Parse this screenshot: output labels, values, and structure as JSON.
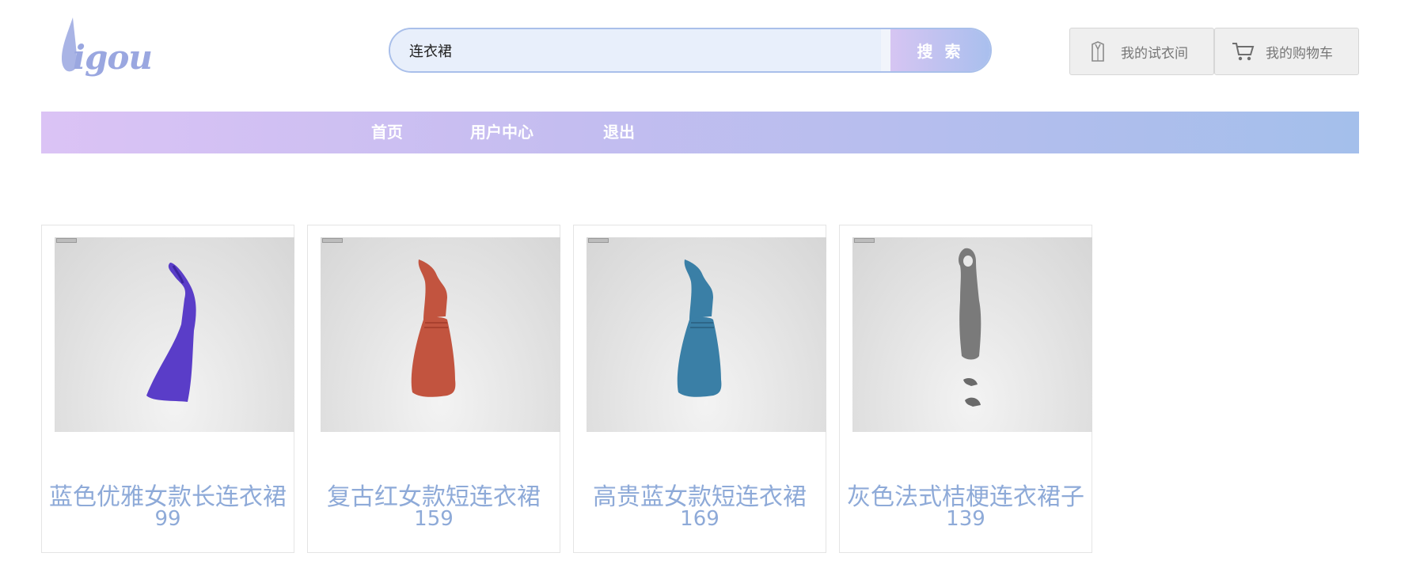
{
  "header": {
    "logo_text": "igou",
    "search": {
      "value": "连衣裙",
      "button_label": "搜 索"
    },
    "closet_label": "我的试衣间",
    "cart_label": "我的购物车"
  },
  "nav": {
    "items": [
      {
        "label": "首页"
      },
      {
        "label": "用户中心"
      },
      {
        "label": "退出"
      }
    ]
  },
  "products": [
    {
      "name": "蓝色优雅女款长连衣裙",
      "price": "99",
      "color": "#5a3dc8",
      "icon": "dress-icon"
    },
    {
      "name": "复古红女款短连衣裙",
      "price": "159",
      "color": "#c2543f",
      "icon": "dress-icon"
    },
    {
      "name": "高贵蓝女款短连衣裙",
      "price": "169",
      "color": "#3a7fa6",
      "icon": "dress-icon"
    },
    {
      "name": "灰色法式桔梗连衣裙子",
      "price": "139",
      "color": "#7a7a7a",
      "icon": "dress-icon"
    }
  ],
  "colors": {
    "accent": "#8eaad8",
    "nav_start": "#dbc3f5",
    "nav_end": "#a4bfeb"
  }
}
